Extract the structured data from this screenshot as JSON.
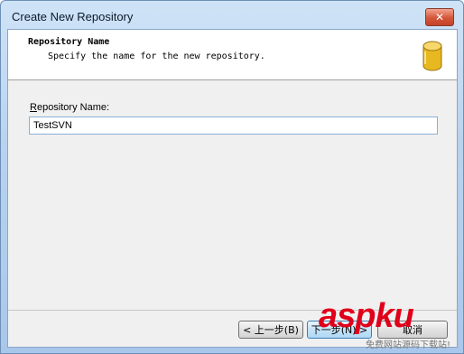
{
  "window": {
    "title": "Create New Repository",
    "close_glyph": "✕"
  },
  "header": {
    "title": "Repository Name",
    "subtitle": "Specify the name for the new repository.",
    "icon": "database-icon"
  },
  "form": {
    "label_mnemonic": "R",
    "label_rest": "epository Name:",
    "value": "TestSVN"
  },
  "buttons": {
    "back": "< 上一步(B)",
    "next": "下一步(N) >",
    "cancel": "取消"
  },
  "watermark": {
    "brand": "aspku",
    "tagline": "免费网站源码下载站!"
  },
  "colors": {
    "title_bar": "#b9d3ef",
    "close_button": "#d45638",
    "header_background": "#ffffff",
    "client_background": "#f0f0f0",
    "input_border": "#8ab0d6",
    "icon_fill": "#e8b820",
    "watermark": "#e0001a"
  }
}
